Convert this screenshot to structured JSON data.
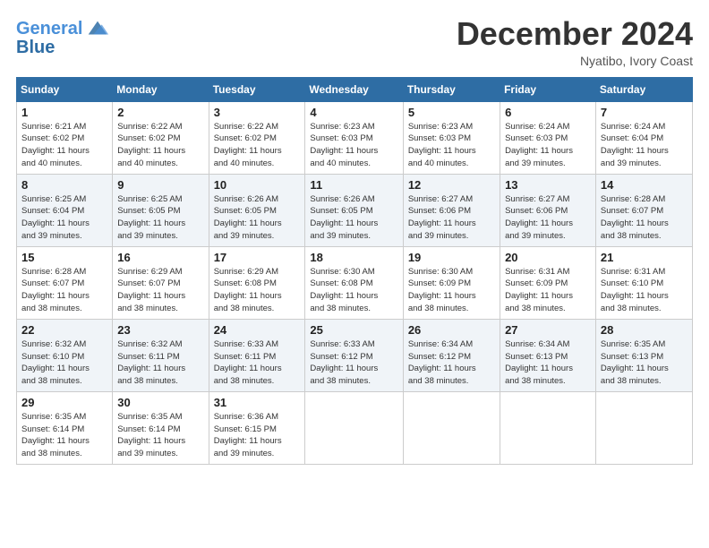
{
  "logo": {
    "line1": "General",
    "line2": "Blue"
  },
  "title": "December 2024",
  "subtitle": "Nyatibo, Ivory Coast",
  "header_days": [
    "Sunday",
    "Monday",
    "Tuesday",
    "Wednesday",
    "Thursday",
    "Friday",
    "Saturday"
  ],
  "weeks": [
    [
      {
        "day": "1",
        "info": "Sunrise: 6:21 AM\nSunset: 6:02 PM\nDaylight: 11 hours\nand 40 minutes."
      },
      {
        "day": "2",
        "info": "Sunrise: 6:22 AM\nSunset: 6:02 PM\nDaylight: 11 hours\nand 40 minutes."
      },
      {
        "day": "3",
        "info": "Sunrise: 6:22 AM\nSunset: 6:02 PM\nDaylight: 11 hours\nand 40 minutes."
      },
      {
        "day": "4",
        "info": "Sunrise: 6:23 AM\nSunset: 6:03 PM\nDaylight: 11 hours\nand 40 minutes."
      },
      {
        "day": "5",
        "info": "Sunrise: 6:23 AM\nSunset: 6:03 PM\nDaylight: 11 hours\nand 40 minutes."
      },
      {
        "day": "6",
        "info": "Sunrise: 6:24 AM\nSunset: 6:03 PM\nDaylight: 11 hours\nand 39 minutes."
      },
      {
        "day": "7",
        "info": "Sunrise: 6:24 AM\nSunset: 6:04 PM\nDaylight: 11 hours\nand 39 minutes."
      }
    ],
    [
      {
        "day": "8",
        "info": "Sunrise: 6:25 AM\nSunset: 6:04 PM\nDaylight: 11 hours\nand 39 minutes."
      },
      {
        "day": "9",
        "info": "Sunrise: 6:25 AM\nSunset: 6:05 PM\nDaylight: 11 hours\nand 39 minutes."
      },
      {
        "day": "10",
        "info": "Sunrise: 6:26 AM\nSunset: 6:05 PM\nDaylight: 11 hours\nand 39 minutes."
      },
      {
        "day": "11",
        "info": "Sunrise: 6:26 AM\nSunset: 6:05 PM\nDaylight: 11 hours\nand 39 minutes."
      },
      {
        "day": "12",
        "info": "Sunrise: 6:27 AM\nSunset: 6:06 PM\nDaylight: 11 hours\nand 39 minutes."
      },
      {
        "day": "13",
        "info": "Sunrise: 6:27 AM\nSunset: 6:06 PM\nDaylight: 11 hours\nand 39 minutes."
      },
      {
        "day": "14",
        "info": "Sunrise: 6:28 AM\nSunset: 6:07 PM\nDaylight: 11 hours\nand 38 minutes."
      }
    ],
    [
      {
        "day": "15",
        "info": "Sunrise: 6:28 AM\nSunset: 6:07 PM\nDaylight: 11 hours\nand 38 minutes."
      },
      {
        "day": "16",
        "info": "Sunrise: 6:29 AM\nSunset: 6:07 PM\nDaylight: 11 hours\nand 38 minutes."
      },
      {
        "day": "17",
        "info": "Sunrise: 6:29 AM\nSunset: 6:08 PM\nDaylight: 11 hours\nand 38 minutes."
      },
      {
        "day": "18",
        "info": "Sunrise: 6:30 AM\nSunset: 6:08 PM\nDaylight: 11 hours\nand 38 minutes."
      },
      {
        "day": "19",
        "info": "Sunrise: 6:30 AM\nSunset: 6:09 PM\nDaylight: 11 hours\nand 38 minutes."
      },
      {
        "day": "20",
        "info": "Sunrise: 6:31 AM\nSunset: 6:09 PM\nDaylight: 11 hours\nand 38 minutes."
      },
      {
        "day": "21",
        "info": "Sunrise: 6:31 AM\nSunset: 6:10 PM\nDaylight: 11 hours\nand 38 minutes."
      }
    ],
    [
      {
        "day": "22",
        "info": "Sunrise: 6:32 AM\nSunset: 6:10 PM\nDaylight: 11 hours\nand 38 minutes."
      },
      {
        "day": "23",
        "info": "Sunrise: 6:32 AM\nSunset: 6:11 PM\nDaylight: 11 hours\nand 38 minutes."
      },
      {
        "day": "24",
        "info": "Sunrise: 6:33 AM\nSunset: 6:11 PM\nDaylight: 11 hours\nand 38 minutes."
      },
      {
        "day": "25",
        "info": "Sunrise: 6:33 AM\nSunset: 6:12 PM\nDaylight: 11 hours\nand 38 minutes."
      },
      {
        "day": "26",
        "info": "Sunrise: 6:34 AM\nSunset: 6:12 PM\nDaylight: 11 hours\nand 38 minutes."
      },
      {
        "day": "27",
        "info": "Sunrise: 6:34 AM\nSunset: 6:13 PM\nDaylight: 11 hours\nand 38 minutes."
      },
      {
        "day": "28",
        "info": "Sunrise: 6:35 AM\nSunset: 6:13 PM\nDaylight: 11 hours\nand 38 minutes."
      }
    ],
    [
      {
        "day": "29",
        "info": "Sunrise: 6:35 AM\nSunset: 6:14 PM\nDaylight: 11 hours\nand 38 minutes."
      },
      {
        "day": "30",
        "info": "Sunrise: 6:35 AM\nSunset: 6:14 PM\nDaylight: 11 hours\nand 39 minutes."
      },
      {
        "day": "31",
        "info": "Sunrise: 6:36 AM\nSunset: 6:15 PM\nDaylight: 11 hours\nand 39 minutes."
      },
      null,
      null,
      null,
      null
    ]
  ]
}
